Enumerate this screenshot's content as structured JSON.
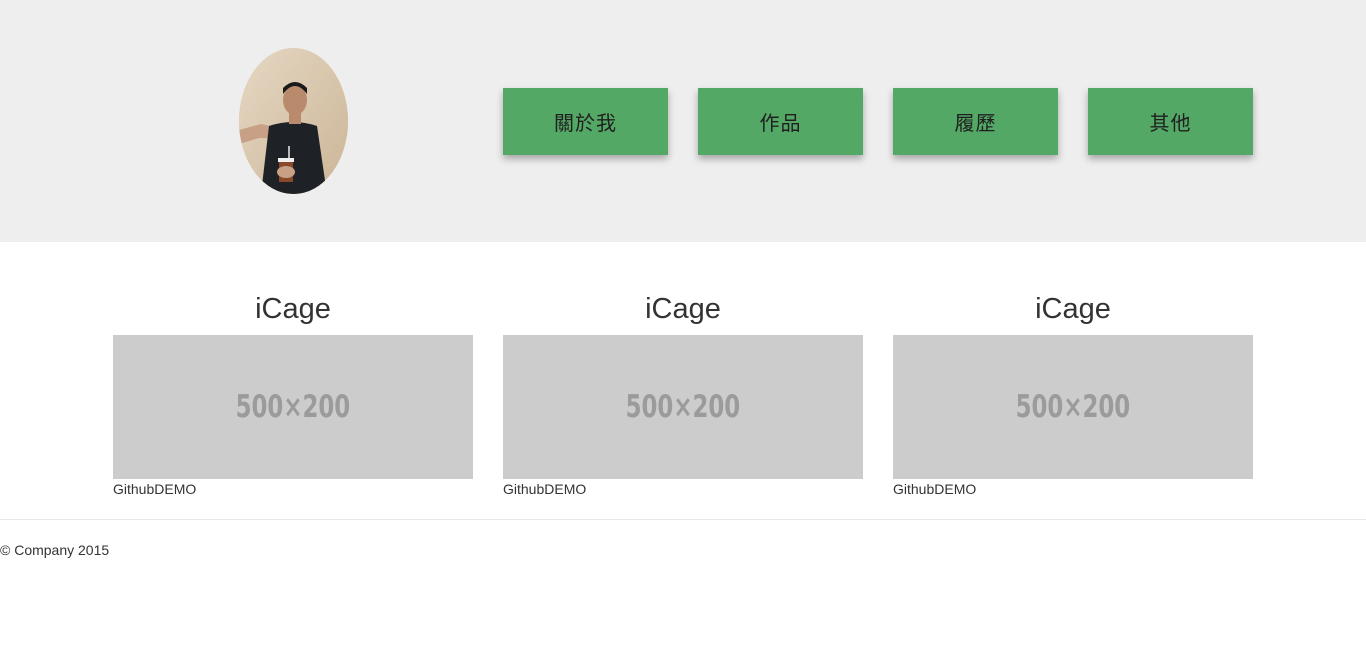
{
  "header": {
    "nav": [
      {
        "label": "關於我"
      },
      {
        "label": "作品"
      },
      {
        "label": "履歷"
      },
      {
        "label": "其他"
      }
    ],
    "nav_color": "#54a865"
  },
  "projects": [
    {
      "title": "iCage",
      "image_placeholder": "500×200",
      "link": "GithubDEMO"
    },
    {
      "title": "iCage",
      "image_placeholder": "500×200",
      "link": "GithubDEMO"
    },
    {
      "title": "iCage",
      "image_placeholder": "500×200",
      "link": "GithubDEMO"
    }
  ],
  "footer": {
    "text": "© Company 2015"
  }
}
